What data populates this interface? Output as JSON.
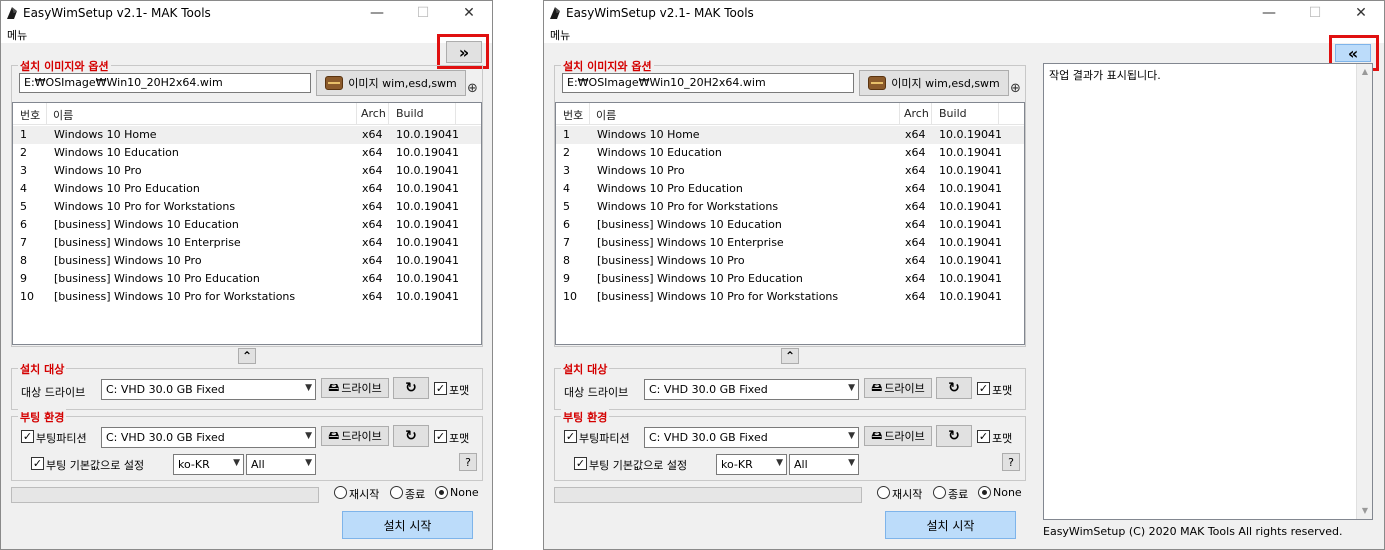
{
  "window_title": "EasyWimSetup v2.1- MAK Tools",
  "title_buttons": {
    "minimize": "—",
    "maximize": "☐",
    "close": "✕"
  },
  "menu": "메뉴",
  "toggle_expand": "»",
  "toggle_collapse": "«",
  "image_group": {
    "title": "설치 이미지와 옵션",
    "path": "E:₩OSImage₩Win10_20H2x64.wim",
    "browse_label": "이미지 wim,esd,swm",
    "zoom_icon": "⊕"
  },
  "editions": {
    "headers": [
      "번호",
      "이름",
      "Arch",
      "Build"
    ],
    "rows": [
      [
        "1",
        "Windows 10 Home",
        "x64",
        "10.0.19041"
      ],
      [
        "2",
        "Windows 10 Education",
        "x64",
        "10.0.19041"
      ],
      [
        "3",
        "Windows 10 Pro",
        "x64",
        "10.0.19041"
      ],
      [
        "4",
        "Windows 10 Pro Education",
        "x64",
        "10.0.19041"
      ],
      [
        "5",
        "Windows 10 Pro for Workstations",
        "x64",
        "10.0.19041"
      ],
      [
        "6",
        "[business] Windows 10 Education",
        "x64",
        "10.0.19041"
      ],
      [
        "7",
        "[business] Windows 10 Enterprise",
        "x64",
        "10.0.19041"
      ],
      [
        "8",
        "[business] Windows 10 Pro",
        "x64",
        "10.0.19041"
      ],
      [
        "9",
        "[business] Windows 10 Pro Education",
        "x64",
        "10.0.19041"
      ],
      [
        "10",
        "[business] Windows 10 Pro for Workstations",
        "x64",
        "10.0.19041"
      ]
    ]
  },
  "collapse_icon": "⌃",
  "target_group": {
    "title": "설치 대상",
    "drive_label": "대상 드라이브",
    "drive_value": "C:  VHD 30.0 GB Fixed",
    "drive_button": "드라이브",
    "refresh": "↻",
    "format_label": "포맷",
    "format_checked": "✓"
  },
  "boot_group": {
    "title": "부팅 환경",
    "partition_label": "부팅파티션",
    "partition_checked": "✓",
    "partition_value": "C:  VHD 30.0 GB Fixed",
    "drive_button": "드라이브",
    "refresh": "↻",
    "format_label": "포맷",
    "format_checked": "✓",
    "defaults_label": "부팅 기본값으로 설정",
    "defaults_checked": "✓",
    "locale_value": "ko-KR",
    "scope_value": "All",
    "help": "?"
  },
  "progress": {
    "value": 0
  },
  "after_options": [
    "재시작",
    "종료",
    "None"
  ],
  "after_selected": "None",
  "start_button": "설치 시작",
  "output": {
    "text": "작업 결과가 표시됩니다.",
    "footer": "EasyWimSetup (C) 2020 MAK Tools All rights reserved."
  },
  "colors": {
    "group_title": "#d40000",
    "highlight_box": "#e01010",
    "primary_button": "#bcdcfa"
  }
}
